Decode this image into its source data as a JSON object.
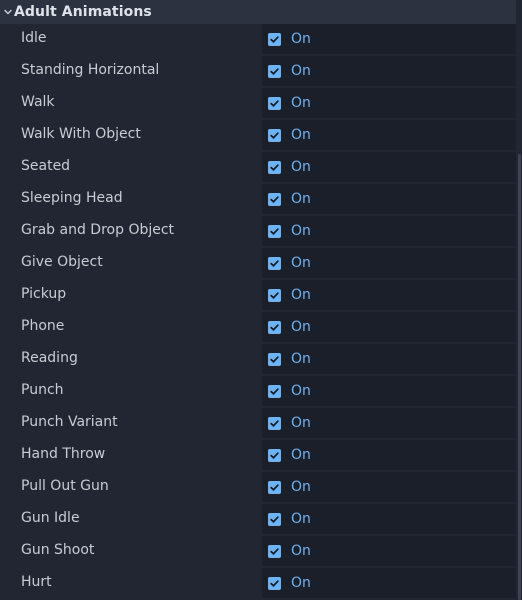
{
  "section": {
    "title": "Adult Animations",
    "expanded": true,
    "chevron_icon": "chevron-down-icon"
  },
  "colors": {
    "background": "#212632",
    "header_background": "#2d3240",
    "value_background": "#1b1f29",
    "accent": "#6eb4f5"
  },
  "properties": [
    {
      "label": "Idle",
      "checked": true,
      "value": "On"
    },
    {
      "label": "Standing Horizontal",
      "checked": true,
      "value": "On"
    },
    {
      "label": "Walk",
      "checked": true,
      "value": "On"
    },
    {
      "label": "Walk With Object",
      "checked": true,
      "value": "On"
    },
    {
      "label": "Seated",
      "checked": true,
      "value": "On"
    },
    {
      "label": "Sleeping Head",
      "checked": true,
      "value": "On"
    },
    {
      "label": "Grab and Drop Object",
      "checked": true,
      "value": "On"
    },
    {
      "label": "Give Object",
      "checked": true,
      "value": "On"
    },
    {
      "label": "Pickup",
      "checked": true,
      "value": "On"
    },
    {
      "label": "Phone",
      "checked": true,
      "value": "On"
    },
    {
      "label": "Reading",
      "checked": true,
      "value": "On"
    },
    {
      "label": "Punch",
      "checked": true,
      "value": "On"
    },
    {
      "label": "Punch Variant",
      "checked": true,
      "value": "On"
    },
    {
      "label": "Hand Throw",
      "checked": true,
      "value": "On"
    },
    {
      "label": "Pull Out Gun",
      "checked": true,
      "value": "On"
    },
    {
      "label": "Gun Idle",
      "checked": true,
      "value": "On"
    },
    {
      "label": "Gun Shoot",
      "checked": true,
      "value": "On"
    },
    {
      "label": "Hurt",
      "checked": true,
      "value": "On"
    }
  ]
}
